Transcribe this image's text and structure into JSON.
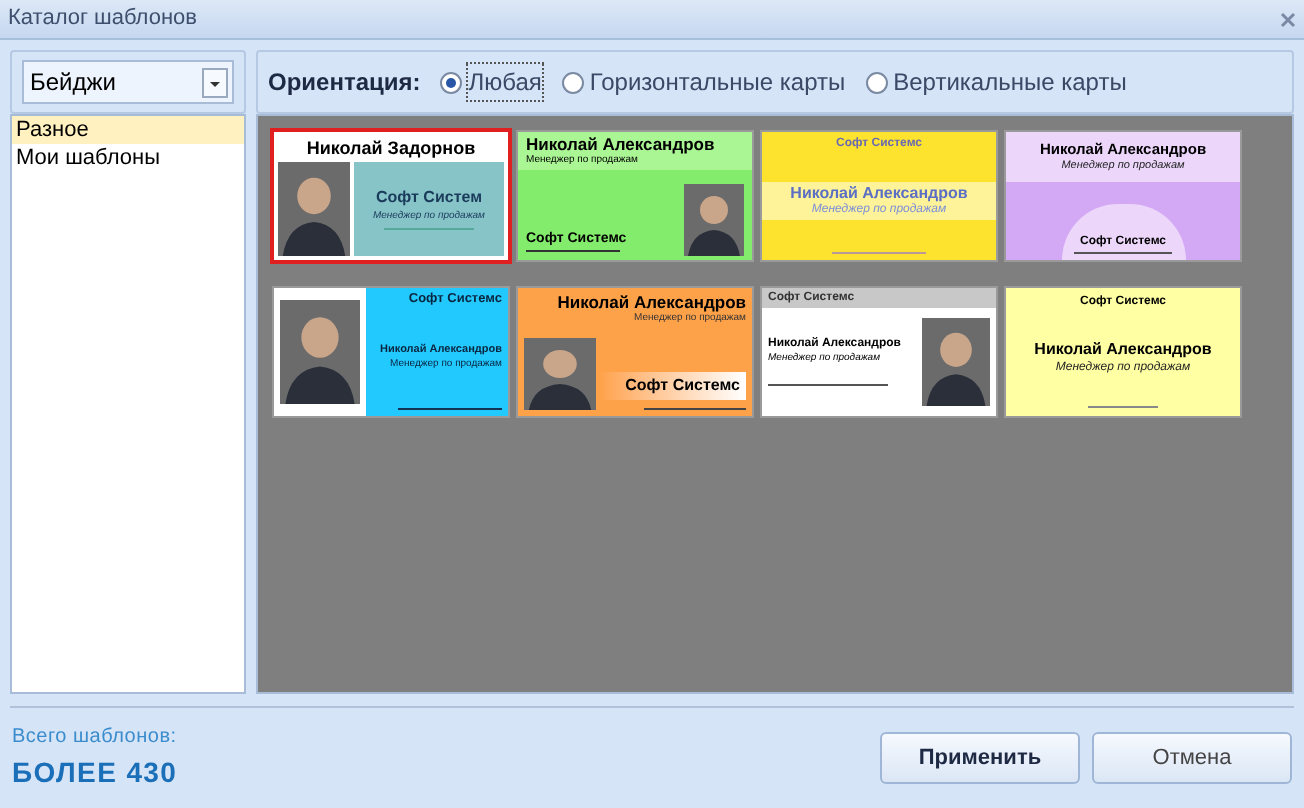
{
  "window": {
    "title": "Каталог шаблонов"
  },
  "category_select": {
    "value": "Бейджи"
  },
  "orientation": {
    "label": "Ориентация:",
    "options": [
      {
        "label": "Любая",
        "selected": true
      },
      {
        "label": "Горизонтальные карты",
        "selected": false
      },
      {
        "label": "Вертикальные карты",
        "selected": false
      }
    ]
  },
  "sidebar": {
    "items": [
      {
        "label": "Разное",
        "selected": true
      },
      {
        "label": "Мои шаблоны",
        "selected": false
      }
    ]
  },
  "templates": [
    {
      "kind": "portrait-left",
      "selected": true,
      "name": "Николай Задорнов",
      "company": "Софт  Систем",
      "role": "Менеджер по продажам"
    },
    {
      "kind": "green",
      "selected": false,
      "name": "Николай Александров",
      "company": "Софт Системс",
      "role": "Менеджер по продажам"
    },
    {
      "kind": "yellow",
      "selected": false,
      "name": "Николай Александров",
      "company": "Софт Системс",
      "role": "Менеджер по продажам"
    },
    {
      "kind": "purple",
      "selected": false,
      "name": "Николай Александров",
      "company": "Софт Системс",
      "role": "Менеджер по продажам"
    },
    {
      "kind": "cyan",
      "selected": false,
      "name": "Николай Александров",
      "company": "Софт Системс",
      "role": "Менеджер по продажам"
    },
    {
      "kind": "orange",
      "selected": false,
      "name": "Николай Александров",
      "company": "Софт Системс",
      "role": "Менеджер по продажам"
    },
    {
      "kind": "gray-header",
      "selected": false,
      "name": "Николай Александров",
      "company": "Софт Системс",
      "role": "Менеджер по продажам"
    },
    {
      "kind": "pale-yellow",
      "selected": false,
      "name": "Николай Александров",
      "company": "Софт Системс",
      "role": "Менеджер по продажам"
    }
  ],
  "footer": {
    "caption": "Всего шаблонов:",
    "count": "БОЛЕЕ 430"
  },
  "buttons": [
    {
      "label": "Применить",
      "kind": "primary"
    },
    {
      "label": "Отмена",
      "kind": "secondary"
    }
  ]
}
